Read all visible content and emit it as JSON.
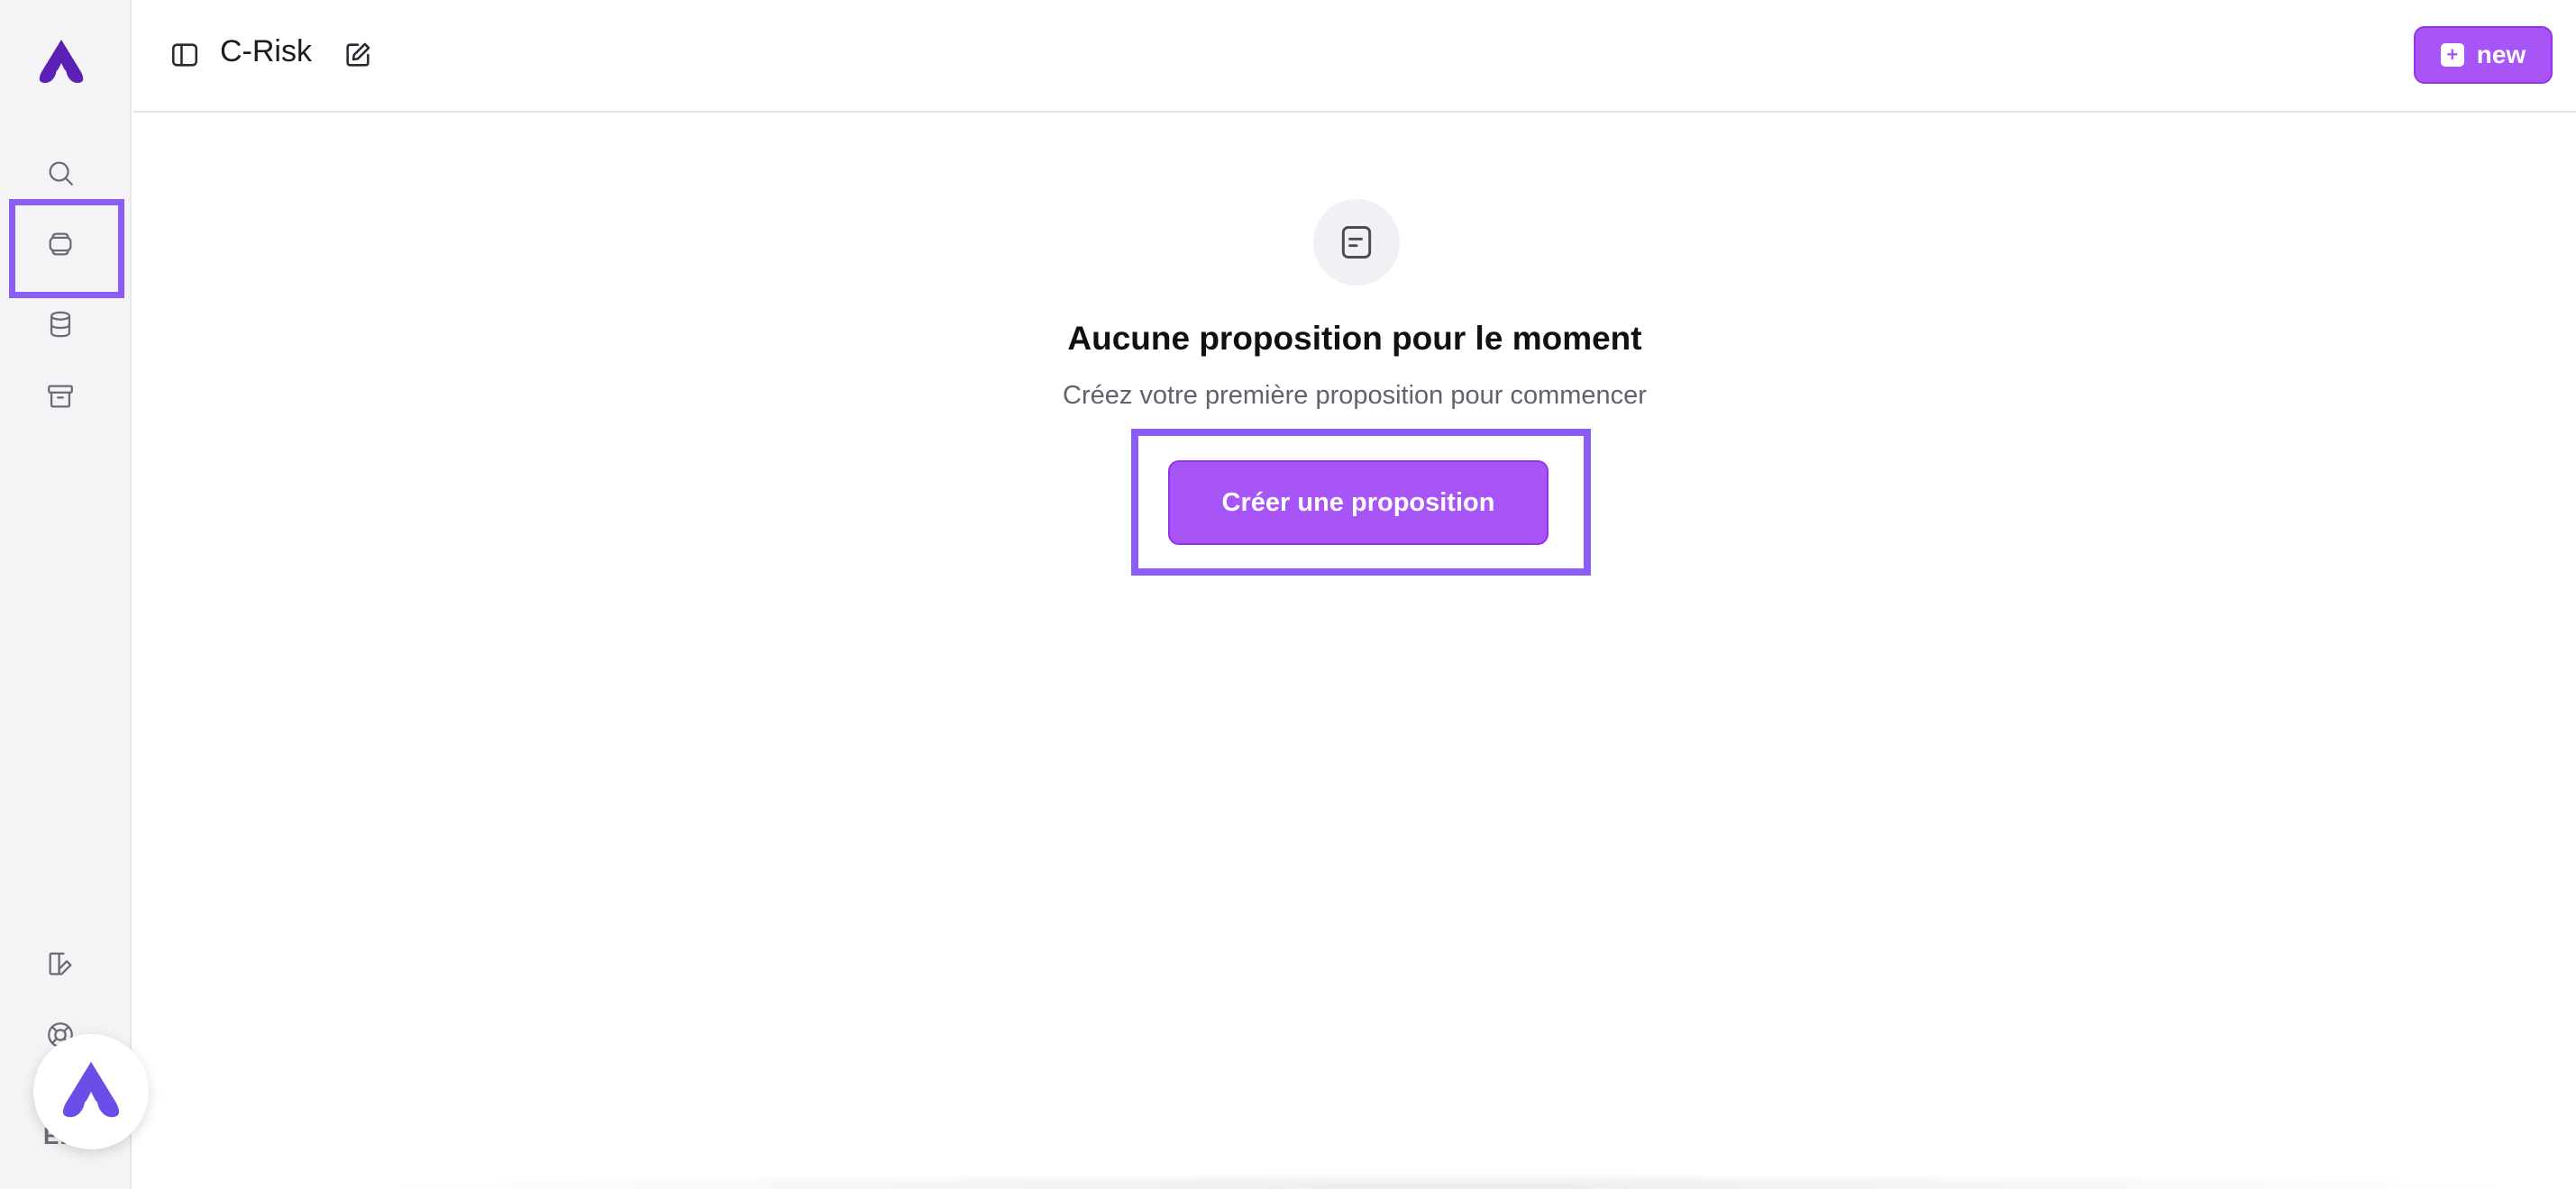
{
  "header": {
    "project_title": "C-Risk",
    "new_button_label": "new",
    "new_button_plus": "+"
  },
  "sidebar": {
    "icons": [
      "search-icon",
      "layers-icon",
      "database-icon",
      "archive-icon",
      "edit-panel-icon",
      "help-icon"
    ],
    "user_initials": "EE"
  },
  "empty_state": {
    "icon": "document-icon",
    "title": "Aucune proposition pour le moment",
    "subtitle": "Créez votre première proposition pour commencer",
    "create_button_label": "Créer une proposition"
  },
  "colors": {
    "accent": "#a855f7",
    "highlight": "#8b5cf6",
    "logo": "#5b21b6",
    "sidebar_bg": "#f4f3f6"
  }
}
